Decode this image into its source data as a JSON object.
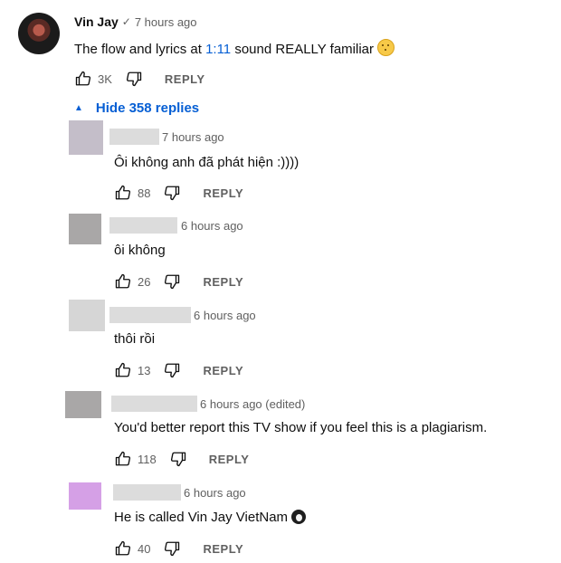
{
  "top_comment": {
    "author": "Vin Jay",
    "verified_mark": "✓",
    "time": "7 hours ago",
    "text_before": "The flow and lyrics at ",
    "timestamp_link": "1:11",
    "text_after": " sound REALLY familiar",
    "emoji": "thinking-face",
    "like_count": "3K",
    "reply_label": "REPLY"
  },
  "replies_toggle": {
    "label": "Hide 358 replies"
  },
  "replies": [
    {
      "time": "7 hours ago",
      "text": "Ôi không anh đã phát hiện :))))",
      "like_count": "88",
      "reply_label": "REPLY",
      "avatar_color": "#c4bec9"
    },
    {
      "time": "6 hours ago",
      "text": "ôi không",
      "like_count": "26",
      "reply_label": "REPLY",
      "avatar_color": "#a9a7a7"
    },
    {
      "time": "6 hours ago",
      "text": "thôi rồi",
      "like_count": "13",
      "reply_label": "REPLY",
      "avatar_color": "#d6d6d6"
    },
    {
      "time": "6 hours ago (edited)",
      "text": "You'd better report this TV show if you feel this is a plagiarism.",
      "like_count": "118",
      "reply_label": "REPLY",
      "avatar_color": "#a9a7a7"
    },
    {
      "time": "6 hours ago",
      "text": "He is called Vin Jay VietNam",
      "like_count": "40",
      "reply_label": "REPLY",
      "avatar_color": "#d5a0e6",
      "emoji": "penguin"
    }
  ]
}
